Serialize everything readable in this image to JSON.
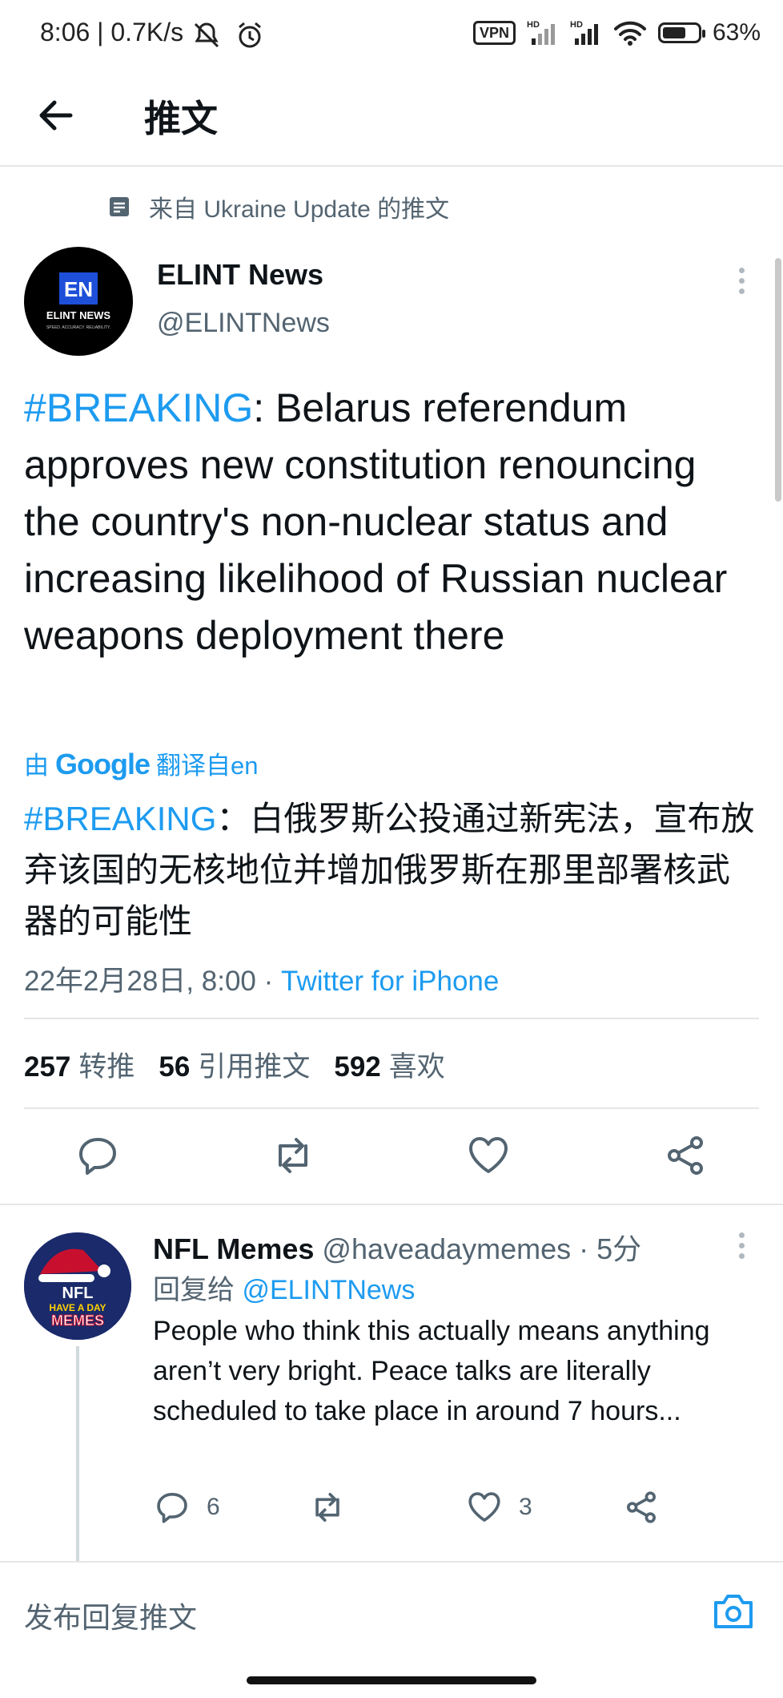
{
  "status_bar": {
    "time": "8:06 | 0.7K/s",
    "vpn": "VPN",
    "signal1": "HD",
    "signal2": "HD",
    "battery": "63%",
    "battery_level": 0.63
  },
  "header": {
    "title": "推文"
  },
  "context": {
    "text": "来自 Ukraine Update 的推文"
  },
  "tweet": {
    "author_name": "ELINT News",
    "author_handle": "@ELINTNews",
    "avatar_badge": "EN",
    "avatar_title": "ELINT NEWS",
    "avatar_tagline": "SPEED. ACCURACY. RELIABILITY.",
    "hashtag": "#BREAKING",
    "text": ": Belarus referendum approves new constitution renouncing the country's non-nuclear status and increasing likelihood of Russian nuclear weapons deployment there",
    "translated_prefix": "由",
    "translated_brand": "Google",
    "translated_suffix": "翻译自en",
    "translated_hashtag": "#BREAKING",
    "translated_text": "：白俄罗斯公投通过新宪法，宣布放弃该国的无核地位并增加俄罗斯在那里部署核武器的可能性",
    "date": "22年2月28日, 8:00 · ",
    "source": "Twitter for iPhone"
  },
  "stats": {
    "retweets": "257",
    "retweets_label": "转推",
    "quotes": "56",
    "quotes_label": "引用推文",
    "likes": "592",
    "likes_label": "喜欢"
  },
  "reply": {
    "name": "NFL Memes",
    "handle_time": " @haveadaymemes · 5分",
    "replying_prefix": "回复给 ",
    "replying_to": "@ELINTNews",
    "avatar_text": "NFL HAVE A DAY MEMES",
    "text": "People who think this actually means anything aren’t very bright. Peace talks are literally scheduled to take place in around 7 hours...",
    "reply_count": "6",
    "like_count": "3"
  },
  "composer": {
    "placeholder": "发布回复推文"
  },
  "colors": {
    "accent": "#1d9bf0",
    "text": "#0f1419",
    "muted": "#536471",
    "border": "#e6e6e6"
  },
  "icons": [
    "back-arrow-icon",
    "note-icon",
    "more-icon",
    "reply-icon",
    "retweet-icon",
    "like-icon",
    "share-icon",
    "camera-icon"
  ]
}
